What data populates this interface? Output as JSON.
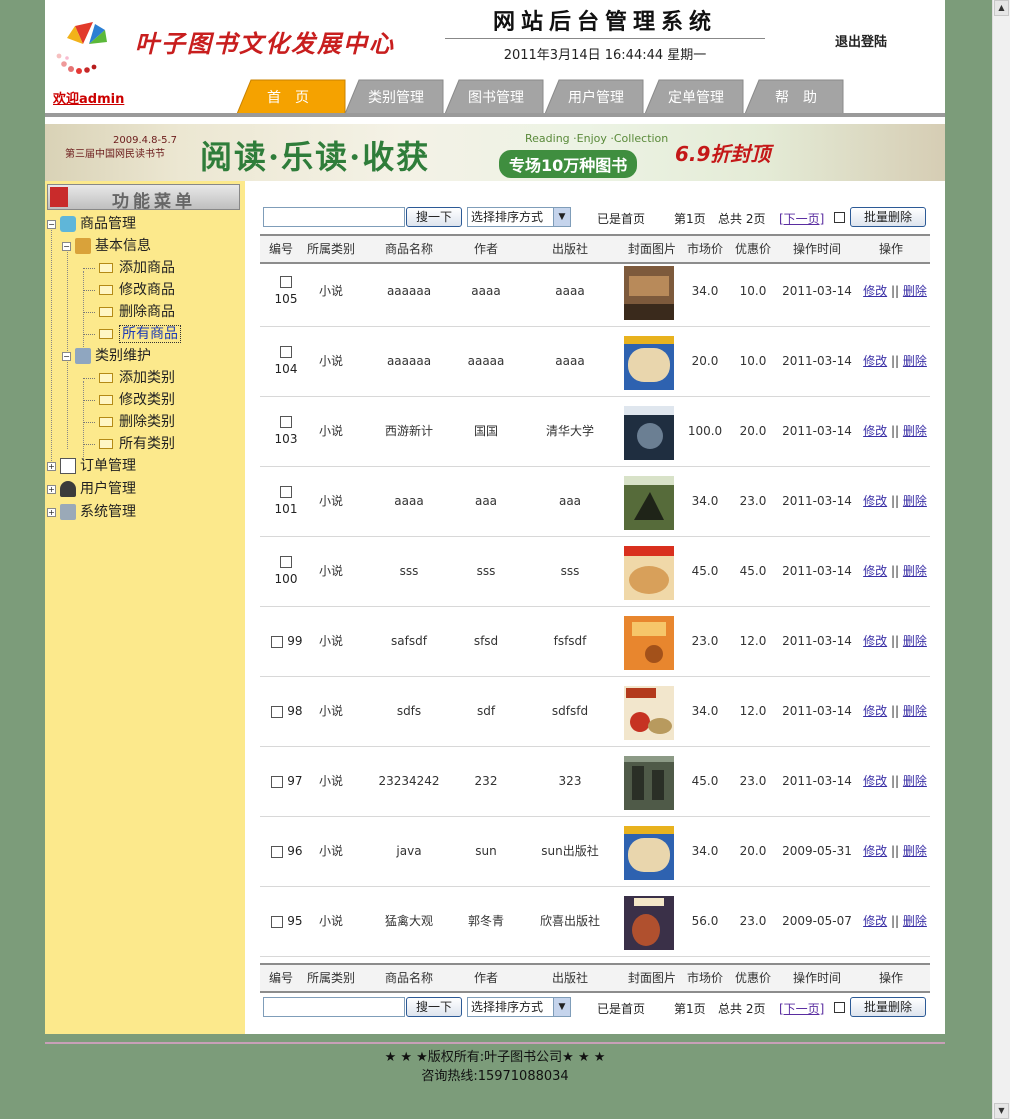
{
  "header": {
    "brand": "叶子图书文化发展中心",
    "welcome": "欢迎admin",
    "system_title": "网站后台管理系统",
    "datetime": "2011年3月14日 16:44:44 星期一",
    "logout": "退出登陆"
  },
  "tabs": [
    {
      "label": "首　页",
      "active": true
    },
    {
      "label": "类别管理",
      "active": false
    },
    {
      "label": "图书管理",
      "active": false
    },
    {
      "label": "用户管理",
      "active": false
    },
    {
      "label": "定单管理",
      "active": false
    },
    {
      "label": "帮　助",
      "active": false
    }
  ],
  "banner": {
    "left_date": "2009.4.8-5.7",
    "left_event": "第三届中国网民读书节",
    "slogan": "阅读·乐读·收获",
    "english": "Reading ·Enjoy ·Collection",
    "sub": "专场10万种图书",
    "discount": "6.9折封顶"
  },
  "sidebar": {
    "title": "功能菜单",
    "goods": "商品管理",
    "basic": "基本信息",
    "basic_items": [
      "添加商品",
      "修改商品",
      "删除商品",
      "所有商品"
    ],
    "category": "类别维护",
    "category_items": [
      "添加类别",
      "修改类别",
      "删除类别",
      "所有类别"
    ],
    "orders": "订单管理",
    "users": "用户管理",
    "system": "系统管理"
  },
  "controls": {
    "search_placeholder": "",
    "search_button": "搜一下",
    "sort_label": "选择排序方式",
    "first_page": "已是首页",
    "page": "第1页",
    "total": "总共 2页",
    "next": "[下一页]",
    "batch_delete": "批量删除"
  },
  "columns": [
    "编号",
    "所属类别",
    "商品名称",
    "作者",
    "出版社",
    "封面图片",
    "市场价",
    "优惠价",
    "操作时间",
    "操作"
  ],
  "rows": [
    {
      "id": "105",
      "category": "小说",
      "name": "aaaaaa",
      "author": "aaaa",
      "publisher": "aaaa",
      "market": "34.0",
      "discount": "10.0",
      "time": "2011-03-14",
      "cover": "#7d5a3c"
    },
    {
      "id": "104",
      "category": "小说",
      "name": "aaaaaa",
      "author": "aaaaa",
      "publisher": "aaaa",
      "market": "20.0",
      "discount": "10.0",
      "time": "2011-03-14",
      "cover": "#c7a66b"
    },
    {
      "id": "103",
      "category": "小说",
      "name": "西游新计",
      "author": "国国",
      "publisher": "清华大学",
      "market": "100.0",
      "discount": "20.0",
      "time": "2011-03-14",
      "cover": "#2a3c52"
    },
    {
      "id": "101",
      "category": "小说",
      "name": "aaaa",
      "author": "aaa",
      "publisher": "aaa",
      "market": "34.0",
      "discount": "23.0",
      "time": "2011-03-14",
      "cover": "#566b3a"
    },
    {
      "id": "100",
      "category": "小说",
      "name": "sss",
      "author": "sss",
      "publisher": "sss",
      "market": "45.0",
      "discount": "45.0",
      "time": "2011-03-14",
      "cover": "#d8a05a"
    },
    {
      "id": "99",
      "category": "小说",
      "name": "safsdf",
      "author": "sfsd",
      "publisher": "fsfsdf",
      "market": "23.0",
      "discount": "12.0",
      "time": "2011-03-14",
      "cover": "#e8862e"
    },
    {
      "id": "98",
      "category": "小说",
      "name": "sdfs",
      "author": "sdf",
      "publisher": "sdfsfd",
      "market": "34.0",
      "discount": "12.0",
      "time": "2011-03-14",
      "cover": "#e8d4b0"
    },
    {
      "id": "97",
      "category": "小说",
      "name": "23234242",
      "author": "232",
      "publisher": "323",
      "market": "45.0",
      "discount": "23.0",
      "time": "2011-03-14",
      "cover": "#4f5a48"
    },
    {
      "id": "96",
      "category": "小说",
      "name": "java",
      "author": "sun",
      "publisher": "sun出版社",
      "market": "34.0",
      "discount": "20.0",
      "time": "2009-05-31",
      "cover": "#c7a66b"
    },
    {
      "id": "95",
      "category": "小说",
      "name": "猛禽大观",
      "author": "郭冬青",
      "publisher": "欣喜出版社",
      "market": "56.0",
      "discount": "23.0",
      "time": "2009-05-07",
      "cover": "#3a3048"
    }
  ],
  "row_ops": {
    "edit": "修改",
    "sep": "||",
    "delete": "删除"
  },
  "footer": {
    "copyright": "★ ★ ★版权所有:叶子图书公司★ ★ ★",
    "hotline": "咨询热线:15971088034"
  },
  "colors": {
    "page_bg": "#7c9c7a",
    "sidebar_bg": "#fce98c",
    "active_tab": "#f5a200",
    "tab": "#a0a0a0",
    "brand": "#c81e1e"
  }
}
